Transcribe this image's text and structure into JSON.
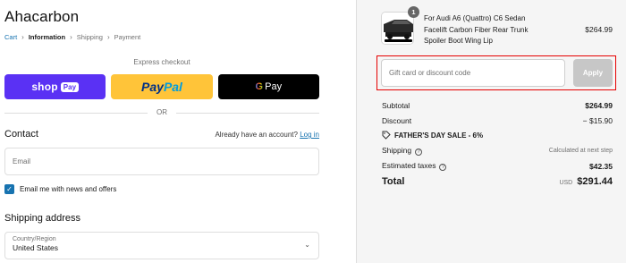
{
  "store": {
    "name": "Ahacarbon"
  },
  "breadcrumb": [
    {
      "label": "Cart"
    },
    {
      "label": "Information"
    },
    {
      "label": "Shipping"
    },
    {
      "label": "Payment"
    }
  ],
  "express": {
    "label": "Express checkout",
    "shop_word": "shop",
    "shop_badge": "Pay",
    "paypal_a": "Pay",
    "paypal_b": "Pal",
    "gpay_g": "G",
    "gpay_word": "Pay",
    "or_label": "OR"
  },
  "contact": {
    "heading": "Contact",
    "have_account": "Already have an account?",
    "login_label": "Log in",
    "email_placeholder": "Email",
    "newsletter_label": "Email me with news and offers",
    "newsletter_checked": true
  },
  "shipping": {
    "heading": "Shipping address",
    "country_label": "Country/Region",
    "country_value": "United States"
  },
  "order": {
    "product_title": "For Audi A6 (Quattro) C6 Sedan Facelift Carbon Fiber Rear Trunk Spoiler Boot Wing Lip",
    "product_price": "$264.99",
    "quantity": "1",
    "discount_placeholder": "Gift card or discount code",
    "apply_label": "Apply",
    "subtotal_label": "Subtotal",
    "subtotal_value": "$264.99",
    "discount_label": "Discount",
    "discount_value": "− $15.90",
    "discount_code": "FATHER'S DAY SALE - 6%",
    "shipping_label": "Shipping",
    "shipping_value": "Calculated at next step",
    "taxes_label": "Estimated taxes",
    "taxes_value": "$42.35",
    "total_label": "Total",
    "total_currency": "USD",
    "total_value": "$291.44"
  },
  "colors": {
    "accent_link": "#1773b0",
    "shop_pay": "#5a31f4",
    "paypal": "#ffc439",
    "highlight_border": "#e60000"
  }
}
